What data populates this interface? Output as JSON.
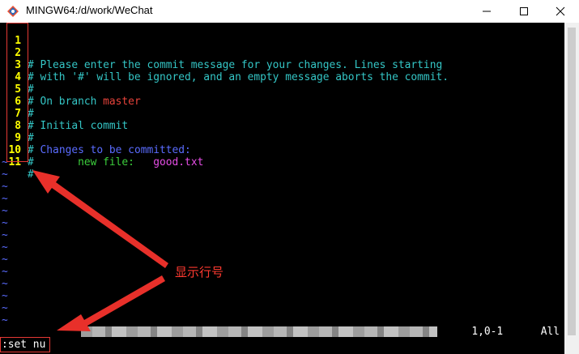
{
  "window": {
    "title": "MINGW64:/d/work/WeChat",
    "buttons": [
      "minimize",
      "maximize",
      "close"
    ]
  },
  "editor": {
    "line_numbers": [
      "1",
      "2",
      "3",
      "4",
      "5",
      "6",
      "7",
      "8",
      "9",
      "10",
      "11"
    ],
    "lines": [
      "",
      "# Please enter the commit message for your changes. Lines starting",
      "# with '#' will be ignored, and an empty message aborts the commit.",
      "#",
      "# On branch ",
      "#",
      "# Initial commit",
      "#",
      "# Changes to be committed:",
      "#       new file:   ",
      "#"
    ],
    "branch_name": "master",
    "changes_header": "Changes to be committed:",
    "new_file_label": "new file:",
    "new_file_name": "good.txt",
    "empty_line_marker": "~",
    "ruler": "1,0-1",
    "ruler_position": "All",
    "command_line": ":set nu"
  },
  "annotation": {
    "label": "显示行号",
    "color": "#ff3a30"
  },
  "colors": {
    "line_number": "#ffff00",
    "comment": "#34c6c6",
    "branch": "#e8433b",
    "keyword": "#5a6cff",
    "new_file_label": "#3ccf3c",
    "file_name": "#e64ee6",
    "tilde": "#5a6cff"
  },
  "icons": {
    "app": "git-bash-icon",
    "minimize": "minimize-icon",
    "maximize": "maximize-icon",
    "close": "close-icon"
  }
}
